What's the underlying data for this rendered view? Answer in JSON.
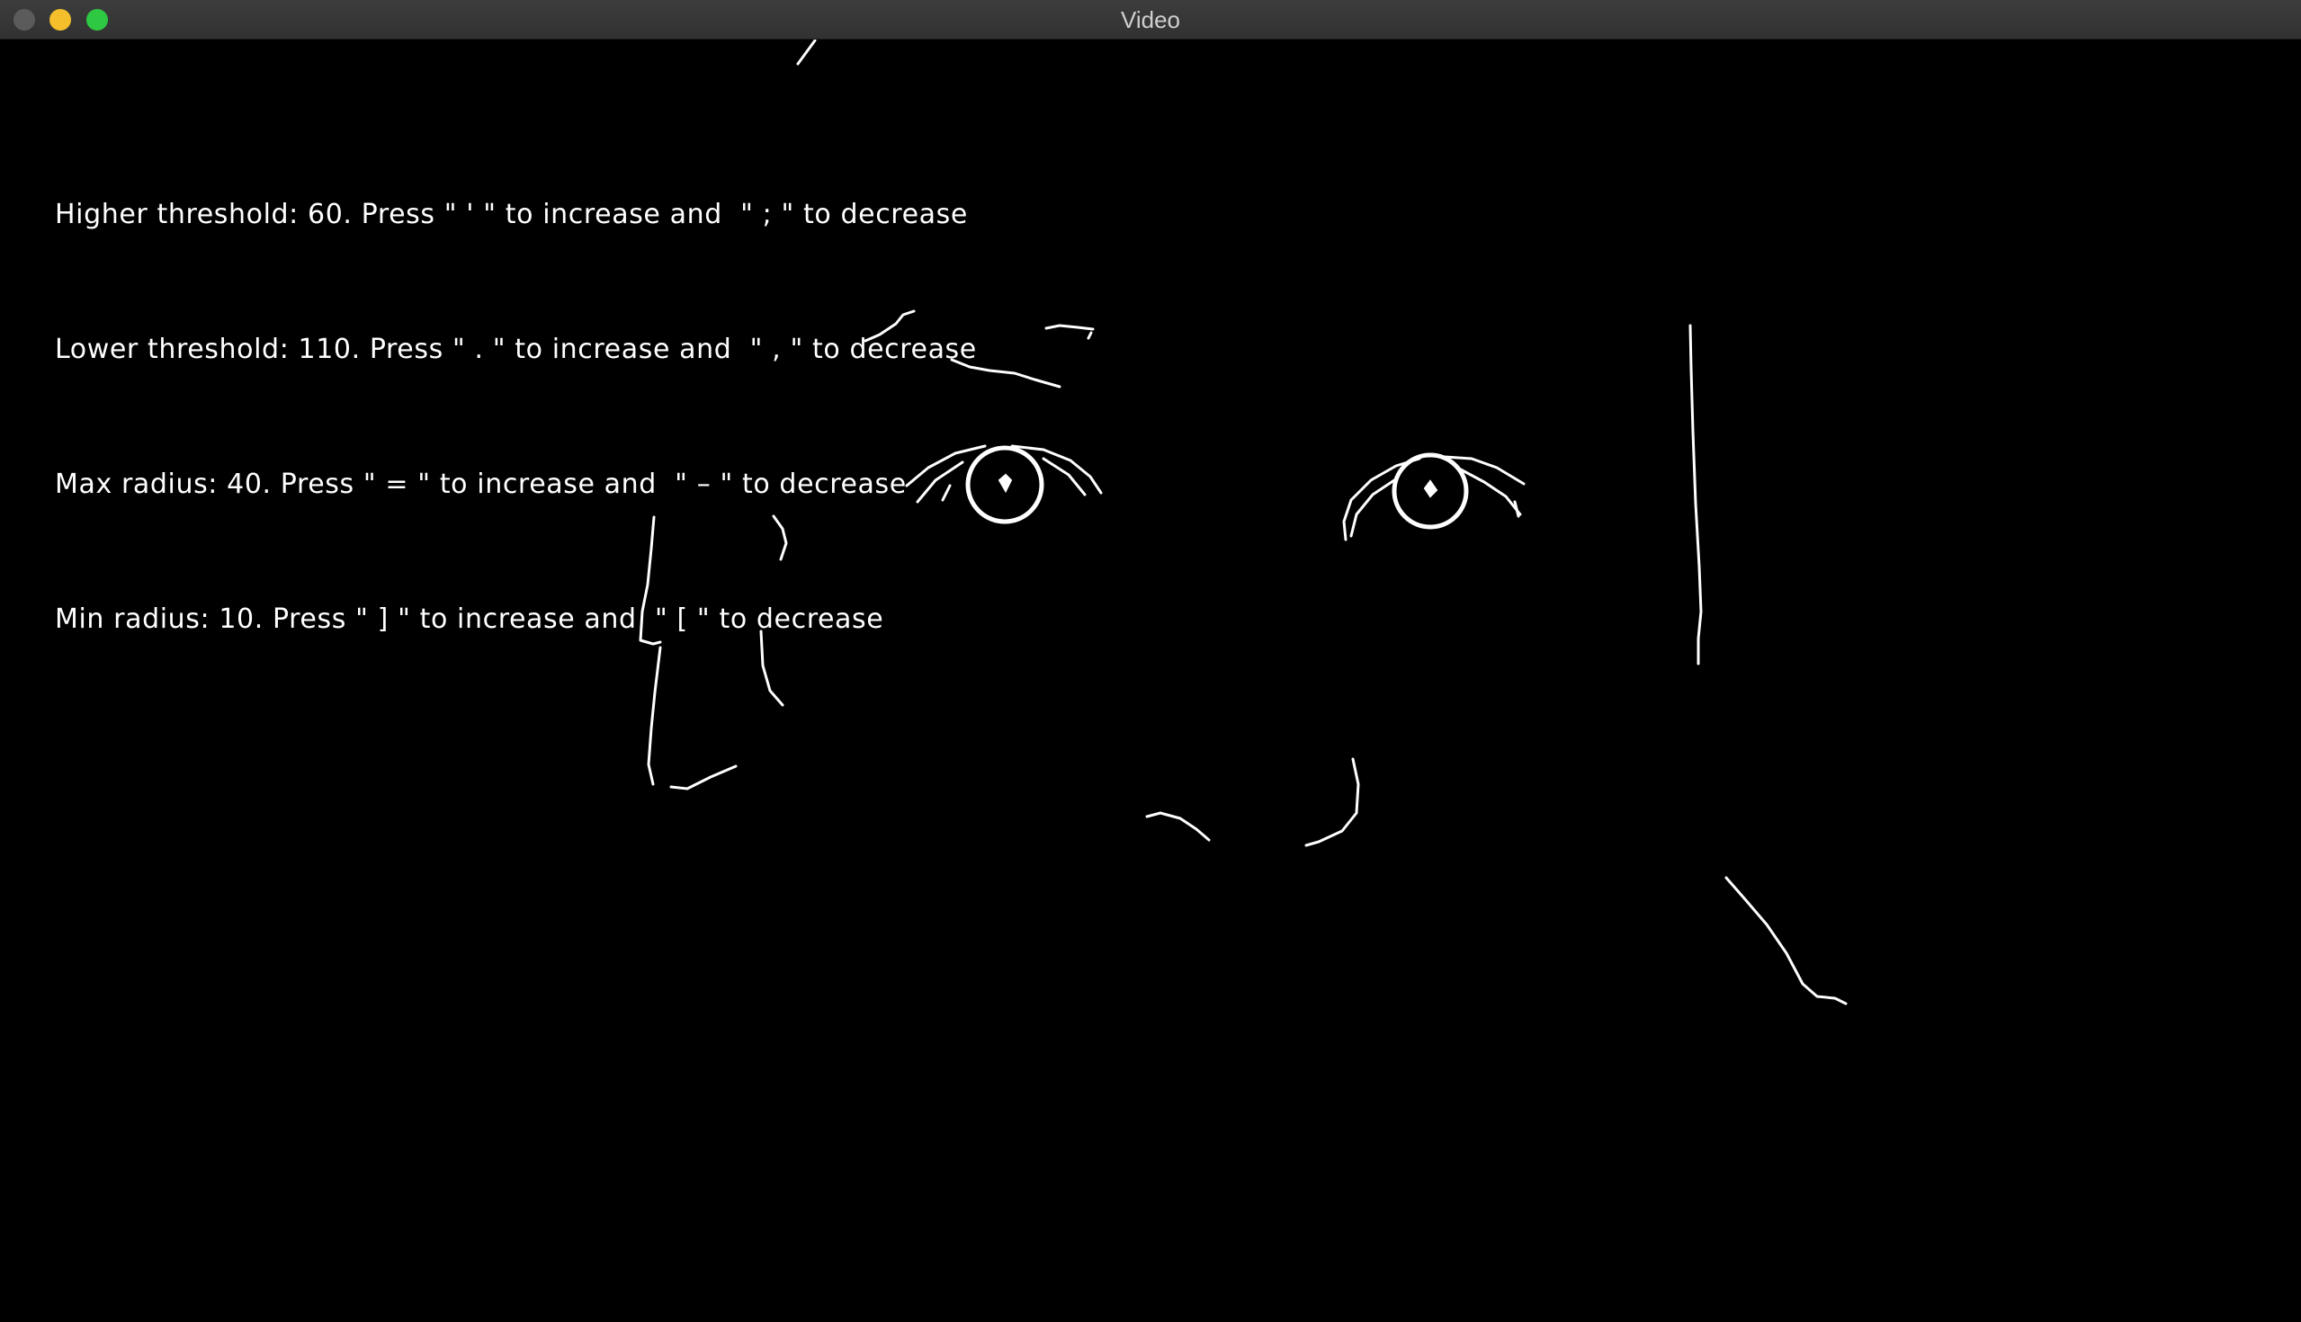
{
  "window": {
    "title": "Video"
  },
  "overlay": {
    "lines": [
      "Higher threshold: 60. Press \" ' \" to increase and  \" ; \" to decrease",
      "Lower threshold: 110. Press \" . \" to increase and  \" , \" to decrease",
      "Max radius: 40. Press \" = \" to increase and  \" – \" to decrease",
      "Min radius: 10. Press \" ] \" to increase and  \" [ \" to decrease"
    ]
  },
  "colors": {
    "background": "#000000",
    "edges": "#ffffff",
    "close_button": "#5b5b5b",
    "minimize_button": "#f5bf2c",
    "zoom_button": "#2fc843"
  }
}
